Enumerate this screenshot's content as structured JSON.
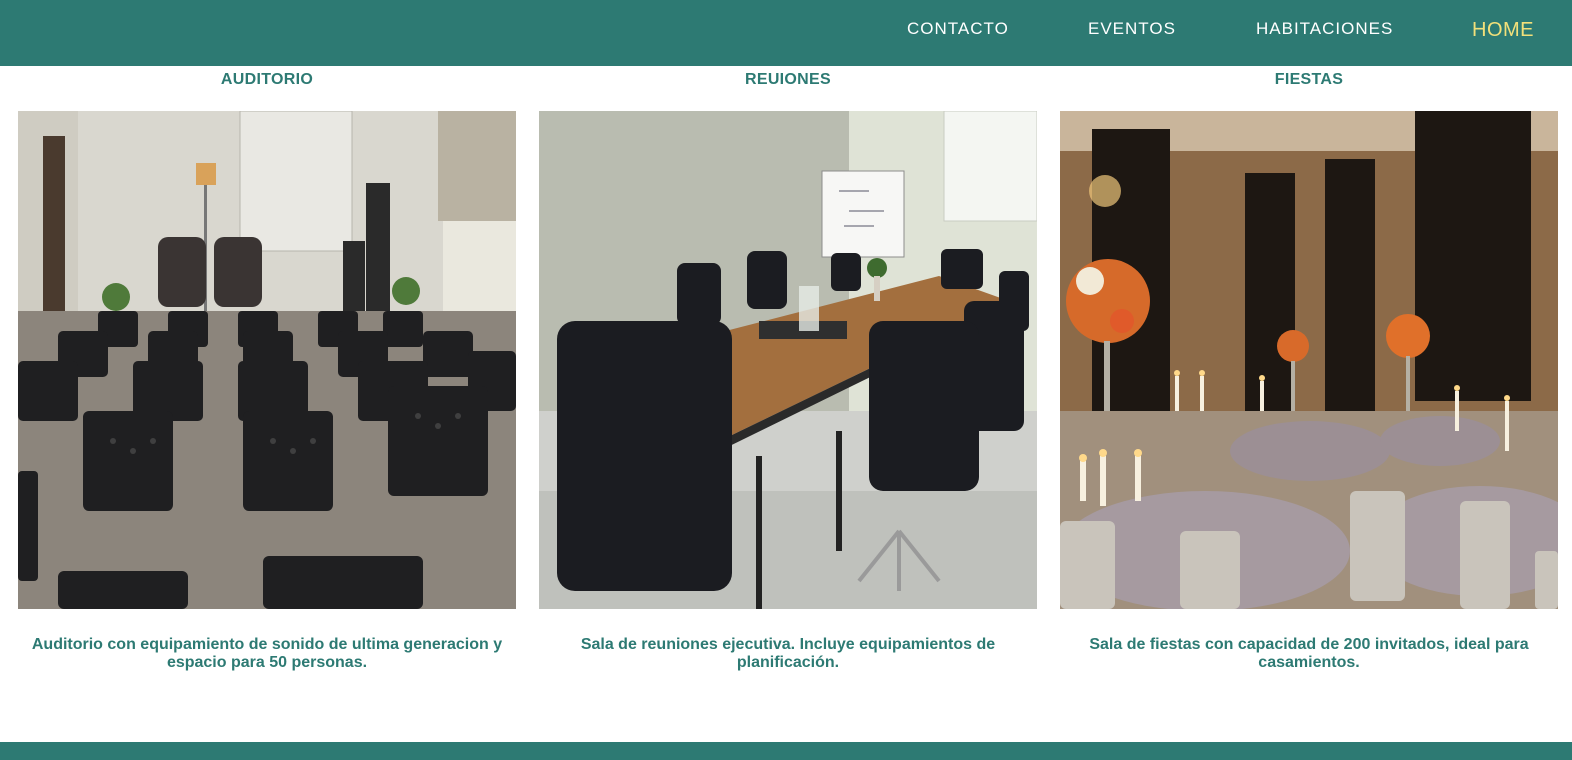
{
  "nav": {
    "contacto": "CONTACTO",
    "eventos": "EVENTOS",
    "habitaciones": "HABITACIONES",
    "home": "HOME"
  },
  "colors": {
    "brand": "#2d7a73",
    "home_accent": "#f2e07a"
  },
  "rooms": [
    {
      "title": "AUDITORIO",
      "description": "Auditorio con equipamiento de sonido de ultima generacion y espacio para 50 personas."
    },
    {
      "title": "REUIONES",
      "description": "Sala de reuniones ejecutiva. Incluye equipamientos de planificación."
    },
    {
      "title": "FIESTAS",
      "description": "Sala de fiestas con capacidad de 200 invitados, ideal para casamientos."
    }
  ]
}
